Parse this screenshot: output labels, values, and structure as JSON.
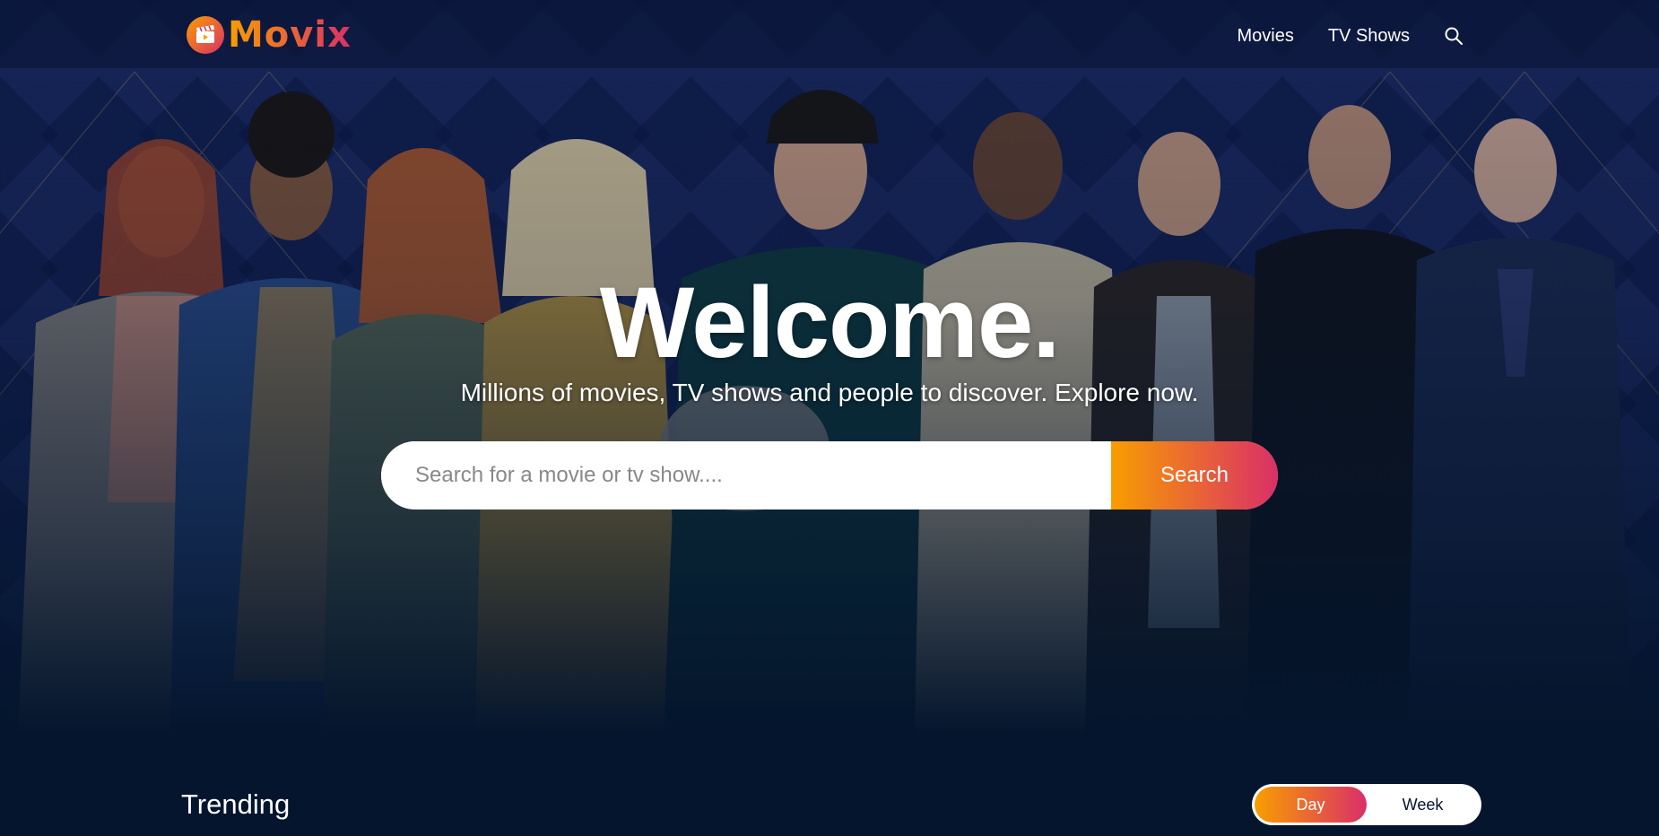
{
  "app": {
    "logo_text": "Movix",
    "logo_icon": "clapperboard-icon"
  },
  "nav": {
    "movies_label": "Movies",
    "tvshows_label": "TV Shows",
    "search_icon": "search-icon"
  },
  "hero": {
    "title": "Welcome.",
    "subtitle": "Millions of movies, TV shows and people to discover. Explore now.",
    "search_placeholder": "Search for a movie or tv show....",
    "search_button_label": "Search"
  },
  "trending": {
    "title": "Trending",
    "tabs": [
      {
        "label": "Day",
        "active": true
      },
      {
        "label": "Week",
        "active": false
      }
    ]
  },
  "colors": {
    "background": "#04152d",
    "accent_start": "#f89e00",
    "accent_end": "#da2f68",
    "text": "#ffffff"
  }
}
